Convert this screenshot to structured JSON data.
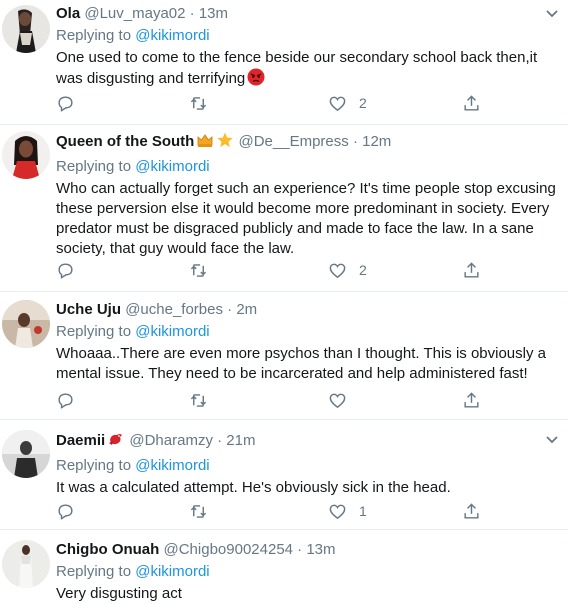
{
  "reply_prefix": "Replying to ",
  "tweets": [
    {
      "name": "Ola",
      "handle": "@Luv_maya02",
      "sep": "·",
      "time": "13m",
      "reply_to": "@kikimordi",
      "text": "One used to come to the fence beside our secondary school back then,it was disgusting and terrifying",
      "likes": "2"
    },
    {
      "name": "Queen of the South",
      "handle": "@De__Empress",
      "sep": "·",
      "time": "12m",
      "reply_to": "@kikimordi",
      "text": "Who can actually forget such an experience? It's time people stop excusing these perversion else it would become more predominant in society. Every predator must be disgraced publicly and made to face the law. In a sane society, that guy would face the law.",
      "likes": "2"
    },
    {
      "name": "Uche Uju",
      "handle": "@uche_forbes",
      "sep": "·",
      "time": "2m",
      "reply_to": "@kikimordi",
      "text": "Whoaaa..There are even more psychos than I thought. This is obviously a mental issue. They need to be incarcerated and help administered fast!",
      "likes": ""
    },
    {
      "name": "Daemii",
      "handle": "@Dharamzy",
      "sep": "·",
      "time": "21m",
      "reply_to": "@kikimordi",
      "text": "It was a calculated attempt. He's obviously sick in the head.",
      "likes": "1"
    },
    {
      "name": "Chigbo Onuah",
      "handle": "@Chigbo90024254",
      "sep": "·",
      "time": "13m",
      "reply_to": "@kikimordi",
      "text": "Very disgusting act",
      "likes": ""
    }
  ],
  "icons": {
    "reply": "reply-icon",
    "retweet": "retweet-icon",
    "like": "like-icon",
    "share": "share-icon",
    "more": "more-chevron-icon"
  },
  "colors": {
    "mention": "#1b95e0",
    "secondary": "#657786",
    "divider": "#e6ecf0"
  }
}
